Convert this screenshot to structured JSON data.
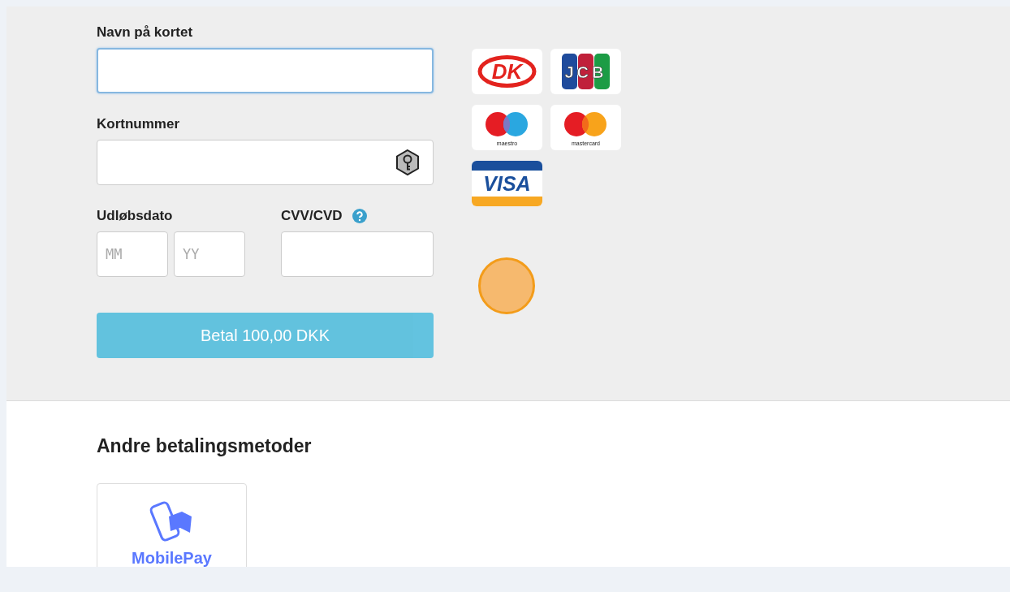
{
  "card_form": {
    "name_field": {
      "label": "Navn på kortet",
      "focused": true
    },
    "number_field": {
      "label": "Kortnummer"
    },
    "expiry": {
      "label": "Udløbsdato",
      "month_placeholder": "MM",
      "year_placeholder": "YY"
    },
    "cvv": {
      "label": "CVV/CVD"
    },
    "pay_button": "Betal 100,00 DKK"
  },
  "card_logos": [
    {
      "kind": "dankort",
      "label": "DK"
    },
    {
      "kind": "jcb",
      "label": "JCB"
    },
    {
      "kind": "maestro",
      "label": "maestro"
    },
    {
      "kind": "mastercard",
      "label": "mastercard"
    },
    {
      "kind": "visa",
      "label": "VISA"
    }
  ],
  "other_methods": {
    "title": "Andre betalingsmetoder",
    "methods": [
      {
        "kind": "mobilepay",
        "label": "MobilePay"
      }
    ]
  }
}
